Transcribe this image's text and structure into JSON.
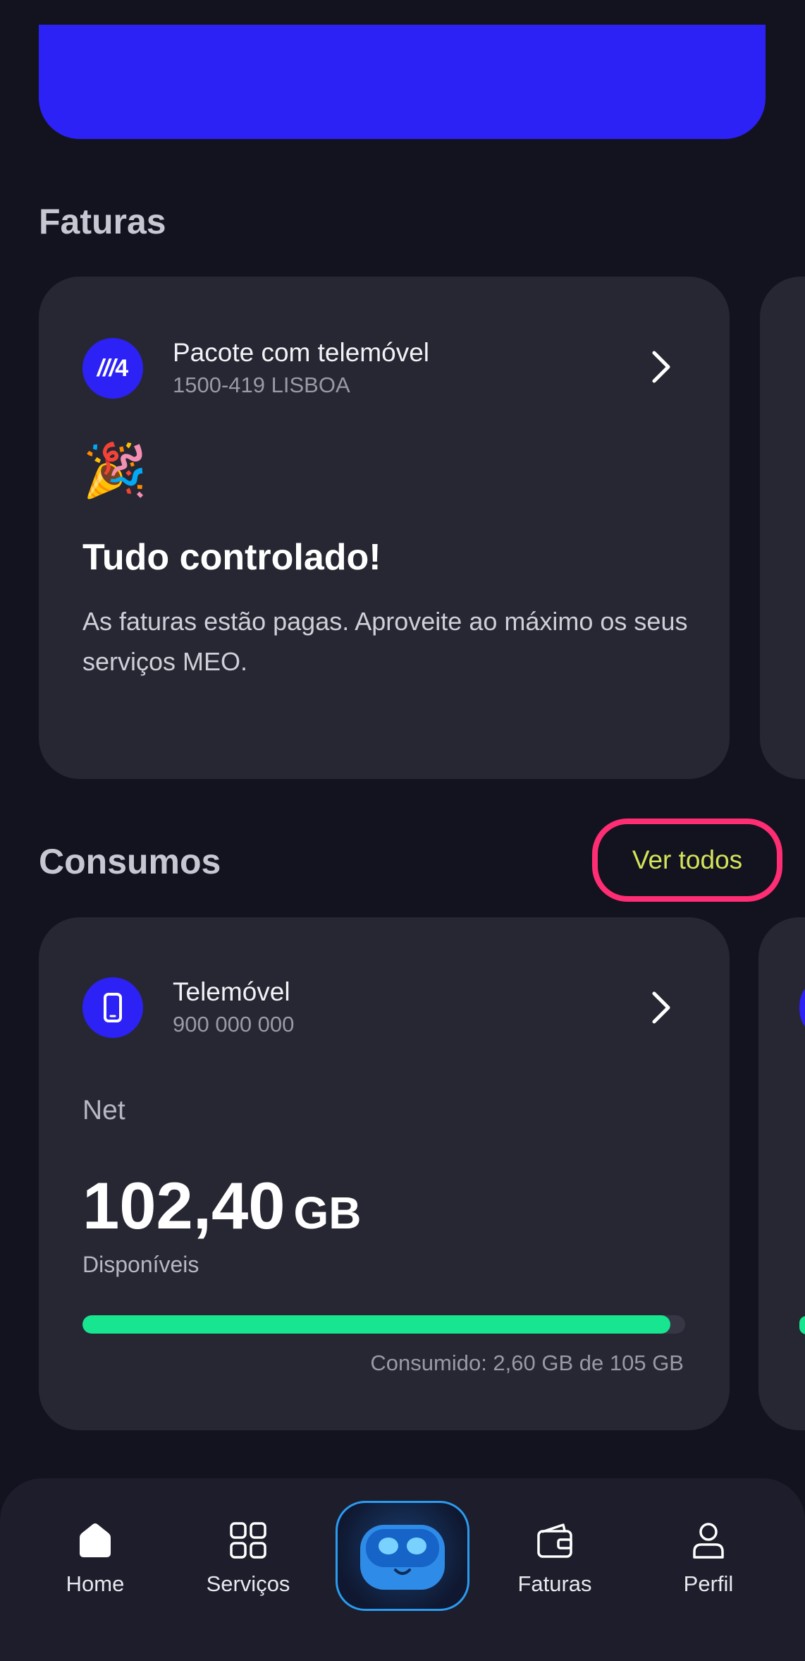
{
  "faturas_section": {
    "title": "Faturas",
    "card": {
      "logo_text": "M4",
      "title": "Pacote com telemóvel",
      "subtitle": "1500-419 LISBOA",
      "emoji": "🎉",
      "heading": "Tudo controlado!",
      "body": "As faturas estão pagas. Aproveite ao máximo os seus serviços MEO."
    }
  },
  "consumos_section": {
    "title": "Consumos",
    "see_all_label": "Ver todos",
    "card": {
      "title": "Telemóvel",
      "subtitle": "900 000 000",
      "metric_label": "Net",
      "value": "102,40",
      "unit": "GB",
      "value_caption": "Disponíveis",
      "progress_fraction": 0.975,
      "consumed_text": "Consumido: 2,60 GB de 105 GB"
    }
  },
  "bottom_nav": {
    "items": [
      {
        "label": "Home",
        "icon": "home-icon"
      },
      {
        "label": "Serviços",
        "icon": "grid-icon"
      },
      {
        "label": "",
        "icon": "assistant-robot-icon"
      },
      {
        "label": "Faturas",
        "icon": "wallet-icon"
      },
      {
        "label": "Perfil",
        "icon": "person-icon"
      }
    ]
  },
  "colors": {
    "background": "#13131f",
    "card": "#272733",
    "brand_blue": "#2c22f5",
    "progress": "#17e58f",
    "link": "#d4e35a",
    "highlight": "#ff2d73"
  }
}
